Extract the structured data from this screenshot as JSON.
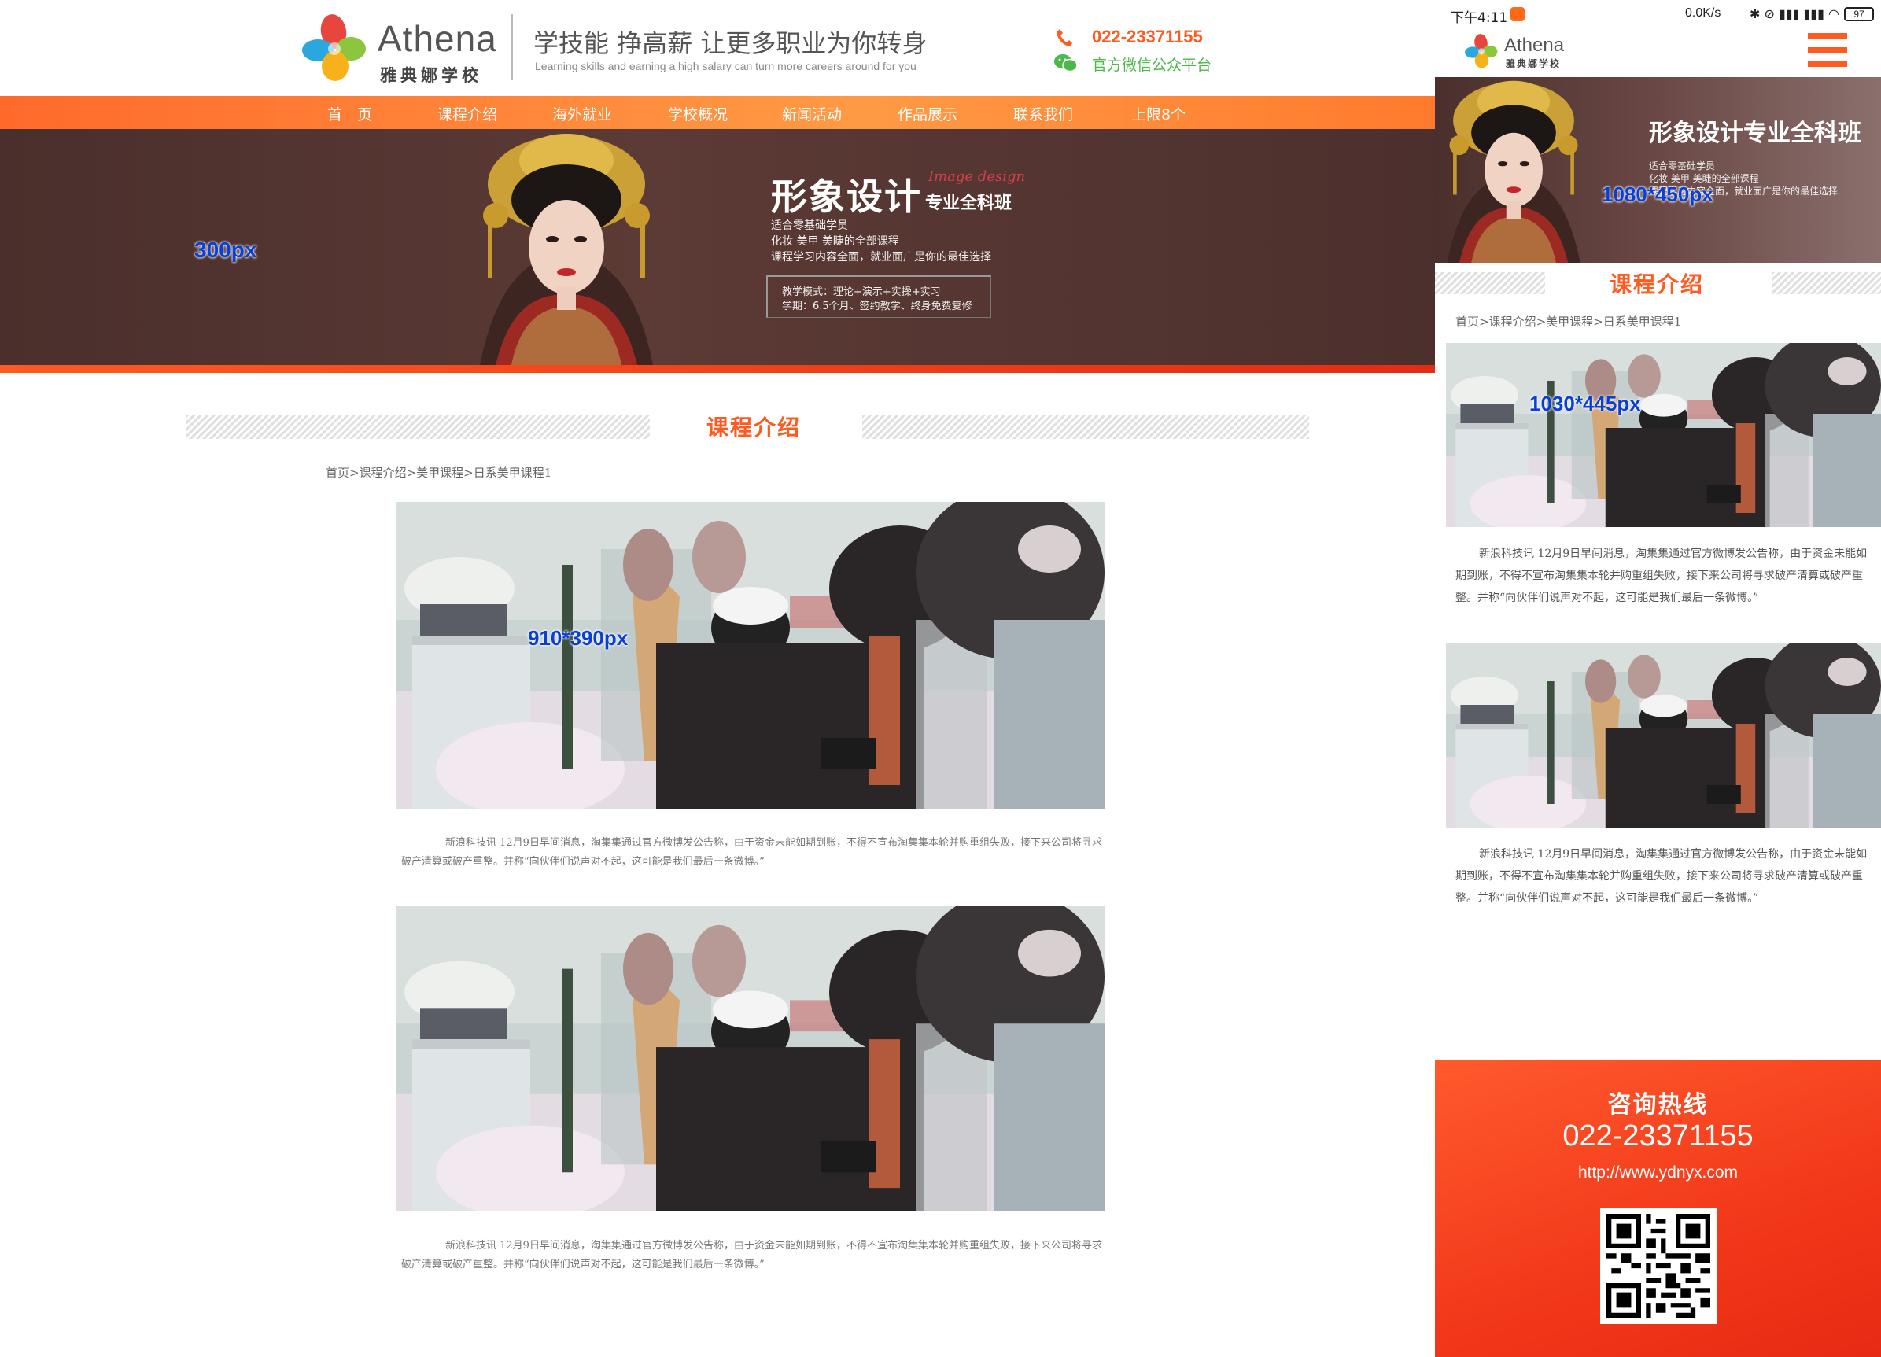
{
  "brand": {
    "name_en": "Athena",
    "name_cn": "雅典娜学校"
  },
  "desktop": {
    "header": {
      "slogan": "学技能 挣高薪 让更多职业为你转身",
      "slogan_en": "Learning skills and earning a high salary can turn more careers around for you",
      "phone": "022-23371155",
      "wechat": "官方微信公众平台"
    },
    "nav": [
      {
        "label": "首　页"
      },
      {
        "label": "课程介绍"
      },
      {
        "label": "海外就业"
      },
      {
        "label": "学校概况"
      },
      {
        "label": "新闻活动"
      },
      {
        "label": "作品展示"
      },
      {
        "label": "联系我们"
      },
      {
        "label": "上限8个"
      }
    ],
    "banner": {
      "title_big": "形象设计",
      "title_small": "专业全科班",
      "script": "Image design",
      "lines": [
        "适合零基础学员",
        "化妆 美甲 美睫的全部课程",
        "课程学习内容全面，就业面广是你的最佳选择"
      ],
      "box_lines": [
        "教学模式：理论+演示+实操+实习",
        "学期：6.5个月、签约教学、终身免费复修"
      ],
      "size_label": "300px"
    },
    "section_title": "课程介绍",
    "breadcrumb": "首页>课程介绍>美甲课程>日系美甲课程1",
    "photo_size_label": "910*390px",
    "paragraph": "新浪科技讯 12月9日早间消息，淘集集通过官方微博发公告称，由于资金未能如期到账，不得不宣布淘集集本轮并购重组失败，接下来公司将寻求破产清算或破产重整。并称“向伙伴们说声对不起，这可能是我们最后一条微博。”"
  },
  "mobile": {
    "status": {
      "time": "下午4:11",
      "speed": "0.0K/s",
      "icons": "✱ ⊘ ▮▮▮ ▮▮▮ ◠",
      "battery": "97"
    },
    "banner": {
      "title": "形象设计专业全科班",
      "lines": [
        "适合零基础学员",
        "化妆 美甲 美睫的全部课程",
        "课程学习内容全面，就业面广是你的最佳选择"
      ],
      "size_label": "1080*450px"
    },
    "section_title": "课程介绍",
    "breadcrumb": "首页>课程介绍>美甲课程>日系美甲课程1",
    "photo_size_label": "1030*445px",
    "paragraph": "新浪科技讯 12月9日早间消息，淘集集通过官方微博发公告称，由于资金未能如期到账，不得不宣布淘集集本轮并购重组失败，接下来公司将寻求破产清算或破产重整。并称“向伙伴们说声对不起，这可能是我们最后一条微博。”",
    "footer": {
      "title": "咨询热线",
      "phone": "022-23371155",
      "url": "http://www.ydnyx.com"
    }
  },
  "colors": {
    "accent": "#ff5a1f",
    "wechat": "#4cb848",
    "label_blue": "#0a3fd6"
  },
  "icons": [
    "logo-mark-icon",
    "phone-icon",
    "wechat-icon",
    "menu-icon",
    "qr-code"
  ]
}
